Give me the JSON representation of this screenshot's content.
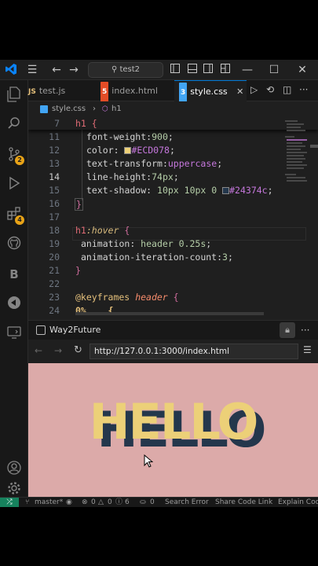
{
  "titlebar": {
    "search": "test2",
    "menu_icon": "hamburger-menu-icon",
    "nav_back_icon": "arrow-left-icon",
    "nav_forward_icon": "arrow-right-icon"
  },
  "activity_bar": {
    "items": [
      "explorer-icon",
      "search-icon",
      "source-control-icon",
      "run-debug-icon",
      "extensions-icon",
      "github-icon",
      "bootstrap-icon",
      "live-share-icon",
      "remote-explorer-icon"
    ],
    "badges": {
      "source_control": "2",
      "extensions": "4"
    },
    "bottom": [
      "account-icon",
      "settings-icon"
    ]
  },
  "tabs": [
    {
      "label": "test.js",
      "icon_text": "JS",
      "icon_color": "#e5c07b"
    },
    {
      "label": "index.html",
      "icon_text": "5",
      "icon_color": "#e34c26"
    },
    {
      "label": "style.css",
      "icon_text": "3",
      "icon_color": "#42a5f5",
      "active": true
    }
  ],
  "breadcrumb": {
    "file": "style.css",
    "sep": "›",
    "symbol": "h1"
  },
  "editor": {
    "sticky": {
      "line": "7",
      "text": "h1 {"
    },
    "current_line": "14",
    "lines": [
      {
        "n": "11",
        "prop": "font-weight",
        "value": "900"
      },
      {
        "n": "12",
        "prop": "color",
        "value": "#ECD078"
      },
      {
        "n": "13",
        "prop": "text-transform",
        "value": "uppercase"
      },
      {
        "n": "14",
        "prop": "line-height",
        "value": "74px"
      },
      {
        "n": "15",
        "prop": "text-shadow",
        "value": "10px 10px 0 ",
        "color_value": "#24374c"
      },
      {
        "n": "16",
        "text": "}"
      },
      {
        "n": "17",
        "text": ""
      },
      {
        "n": "18",
        "selector": "h1",
        "pseudo": ":hover",
        "text": " {"
      },
      {
        "n": "19",
        "prop": "animation",
        "value": "header 0.25s"
      },
      {
        "n": "20",
        "prop": "animation-iteration-count",
        "value": "3"
      },
      {
        "n": "21",
        "text": "}"
      },
      {
        "n": "22",
        "text": ""
      },
      {
        "n": "23",
        "at": "@keyframes",
        "name": "header",
        "text": " {"
      },
      {
        "n": "24",
        "text": "0%    {"
      }
    ],
    "swatch_colors": {
      "ECD078": "#ECD078",
      "24374c": "#24374c"
    }
  },
  "browser": {
    "panel_title": "Way2Future",
    "url": "http://127.0.0.1:3000/index.html",
    "content_text": "HELLO",
    "bg_color": "#dcaaa9"
  },
  "status_bar": {
    "branch": "master*",
    "errors": "0",
    "warnings": "0",
    "info": "6",
    "ports": "0",
    "items": [
      "Search Error",
      "Share Code Link",
      "Explain Cod"
    ]
  }
}
